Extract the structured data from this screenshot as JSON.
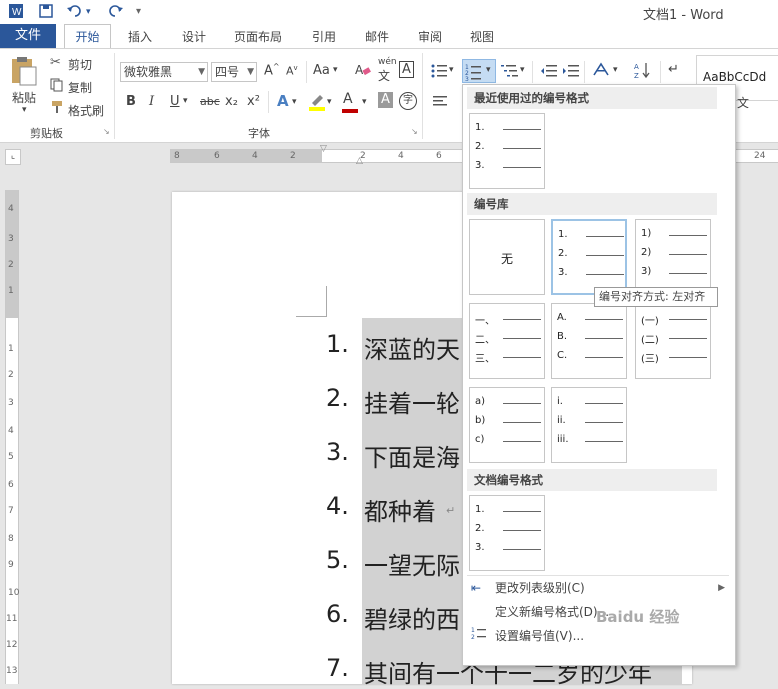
{
  "titlebar": {
    "doc_title": "文档1 - Word",
    "quick_access": [
      "word-app-icon",
      "save-icon",
      "undo-icon",
      "redo-icon",
      "customize-icon"
    ]
  },
  "tabs": {
    "file": "文件",
    "home": "开始",
    "insert": "插入",
    "design": "设计",
    "layout": "页面布局",
    "references": "引用",
    "mailings": "邮件",
    "review": "审阅",
    "view": "视图"
  },
  "ribbon": {
    "clipboard": {
      "group_label": "剪贴板",
      "paste": "粘贴",
      "cut": "剪切",
      "copy": "复制",
      "format_painter": "格式刷"
    },
    "font": {
      "group_label": "字体",
      "font_name": "微软雅黑",
      "font_size": "四号",
      "aa_label": "Aa",
      "bold": "B",
      "italic": "I",
      "underline": "U",
      "strike": "abc",
      "subscript": "x₂",
      "superscript": "x²",
      "text_effect": "A",
      "font_color": "A",
      "char_shade": "A",
      "enclose": "字",
      "phonetic": "wén",
      "phonetic_char": "文",
      "border_char": "A"
    },
    "styles": {
      "preview": "AaBbCcDd",
      "partial_label": "文"
    }
  },
  "ruler": {
    "h_marks": [
      "8",
      "6",
      "4",
      "2",
      "2",
      "4",
      "6",
      "8",
      "24"
    ],
    "v_marks": [
      "4",
      "3",
      "2",
      "1",
      "1",
      "2",
      "3",
      "4",
      "5",
      "6",
      "7",
      "8",
      "9",
      "10",
      "11",
      "12",
      "13"
    ]
  },
  "document": {
    "lines": [
      {
        "num": "1.",
        "text": "深蓝的天"
      },
      {
        "num": "2.",
        "text": "挂着一轮"
      },
      {
        "num": "3.",
        "text": "下面是海"
      },
      {
        "num": "4.",
        "text": "都种着"
      },
      {
        "num": "5.",
        "text": "一望无际"
      },
      {
        "num": "6.",
        "text": "碧绿的西"
      },
      {
        "num": "7.",
        "text": "其间有一个十一二岁的少年"
      }
    ]
  },
  "numbering_menu": {
    "recent_header": "最近使用过的编号格式",
    "library_header": "编号库",
    "document_header": "文档编号格式",
    "none_label": "无",
    "recent": [
      [
        "1.",
        "2.",
        "3."
      ]
    ],
    "library": [
      [
        "1.",
        "2.",
        "3."
      ],
      [
        "1)",
        "2)",
        "3)"
      ],
      [
        "一、",
        "二、",
        "三、"
      ],
      [
        "A.",
        "B.",
        "C."
      ],
      [
        "(一)",
        "(二)",
        "(三)"
      ],
      [
        "a)",
        "b)",
        "c)"
      ],
      [
        "i.",
        "ii.",
        "iii."
      ]
    ],
    "document": [
      [
        "1.",
        "2.",
        "3."
      ]
    ],
    "tooltip": "编号对齐方式: 左对齐",
    "items": {
      "change_level": "更改列表级别(C)",
      "define_new": "定义新编号格式(D)...",
      "set_value": "设置编号值(V)..."
    }
  },
  "watermark": "Baidu 经验",
  "colors": {
    "accent": "#2b579a",
    "selection": "#d2d2d2",
    "highlight_yellow": "#ffff00",
    "font_red": "#c00000"
  }
}
